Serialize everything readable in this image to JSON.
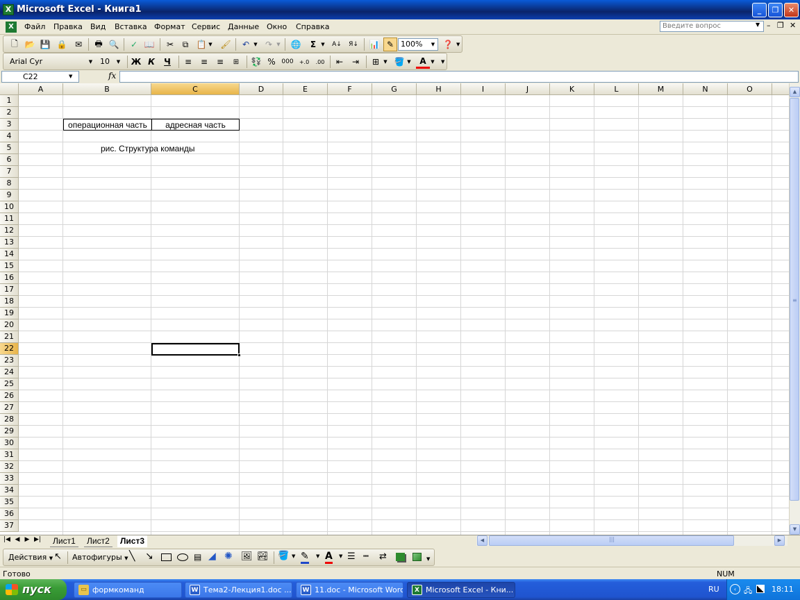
{
  "window": {
    "title": "Microsoft Excel - Книга1",
    "app_icon": "excel-icon"
  },
  "menu": {
    "items": [
      "Файл",
      "Правка",
      "Вид",
      "Вставка",
      "Формат",
      "Сервис",
      "Данные",
      "Окно",
      "Справка"
    ],
    "help_placeholder": "Введите вопрос"
  },
  "toolbar": {
    "zoom": "100%"
  },
  "format_toolbar": {
    "font": "Arial Cyr",
    "size": "10",
    "bold_label": "Ж",
    "italic_label": "К",
    "underline_label": "Ч",
    "percent_label": "%",
    "thousands_label": "000"
  },
  "formula_bar": {
    "name_box": "C22",
    "fx_label": "fx",
    "content": ""
  },
  "grid": {
    "columns": [
      "A",
      "B",
      "C",
      "D",
      "E",
      "F",
      "G",
      "H",
      "I",
      "J",
      "K",
      "L",
      "M",
      "N",
      "O"
    ],
    "rows": [
      "1",
      "2",
      "3",
      "4",
      "5",
      "6",
      "7",
      "8",
      "9",
      "10",
      "11",
      "12",
      "13",
      "14",
      "15",
      "16",
      "17",
      "18",
      "19",
      "20",
      "21",
      "22",
      "23",
      "24",
      "25",
      "26",
      "27",
      "28",
      "29",
      "30",
      "31",
      "32",
      "33",
      "34",
      "35",
      "36",
      "37"
    ],
    "selected_cell": "C22",
    "cells": {
      "b3": "операционная часть",
      "c3": "адресная часть",
      "b5": "рис. Структура команды"
    }
  },
  "sheet_tabs": [
    "Лист1",
    "Лист2",
    "Лист3"
  ],
  "active_sheet": "Лист3",
  "drawing_toolbar": {
    "actions_label": "Действия",
    "autoshapes_label": "Автофигуры"
  },
  "status": {
    "left": "Готово",
    "num": "NUM"
  },
  "taskbar": {
    "start_label": "пуск",
    "tasks": [
      "формкоманд",
      "Тема2-Лекция1.doc ...",
      "11.doc - Microsoft Word",
      "Microsoft Excel - Кни..."
    ],
    "lang": "RU",
    "clock": "18:11"
  }
}
